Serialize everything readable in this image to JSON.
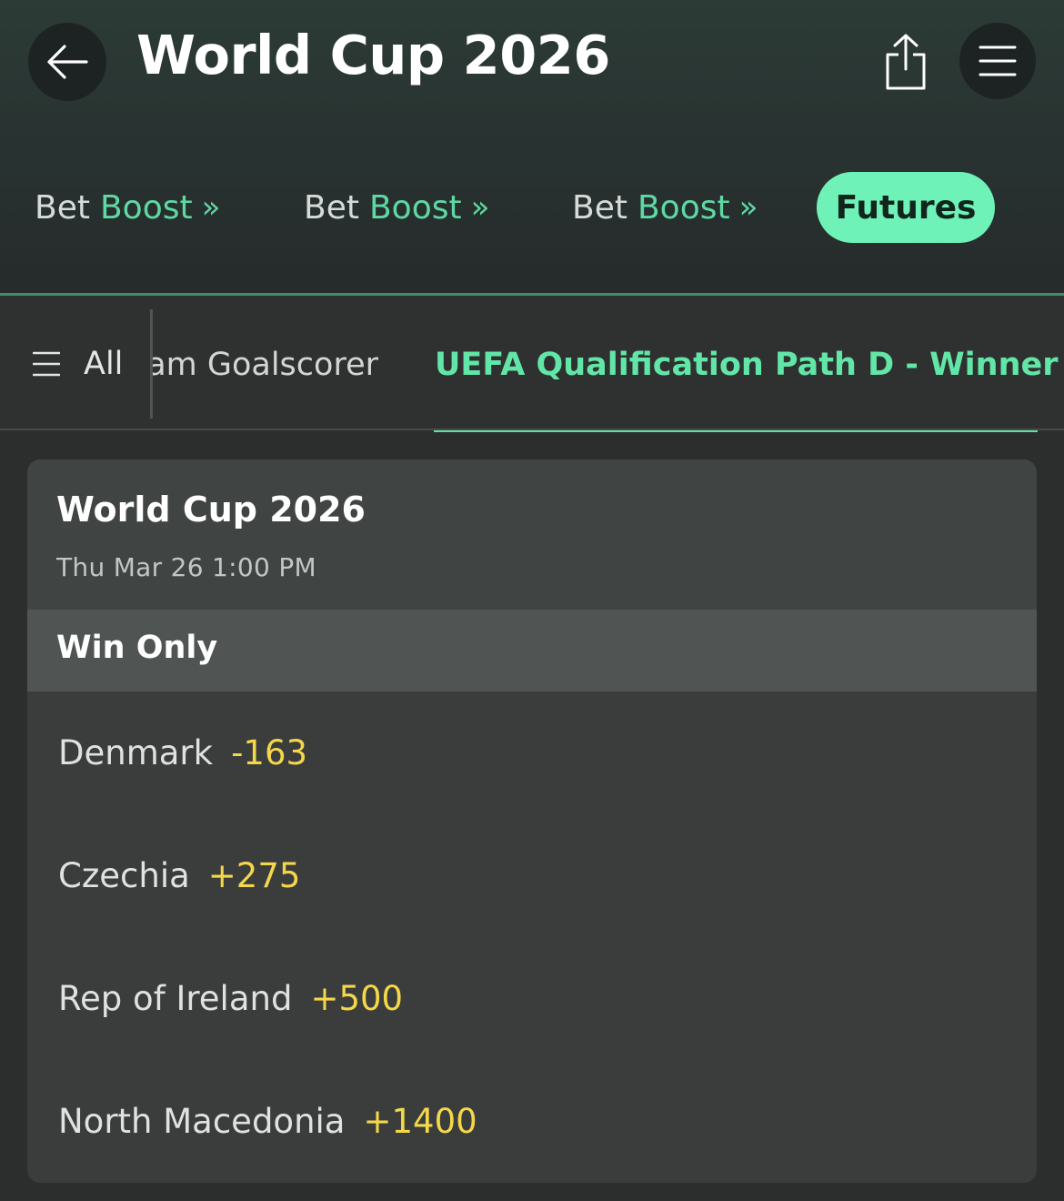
{
  "header": {
    "title": "World Cup 2026",
    "back_icon": "arrow-left-icon",
    "share_icon": "share-icon",
    "menu_icon": "hamburger-menu-icon"
  },
  "top_tabs": [
    {
      "word1": "Bet",
      "word2": "Boost",
      "chevron": "»"
    },
    {
      "word1": "Bet",
      "word2": "Boost",
      "chevron": "»"
    },
    {
      "word1": "Bet",
      "word2": "Boost",
      "chevron": "»"
    }
  ],
  "futures_tab": {
    "label": "Futures",
    "active": true
  },
  "sub_tabs": {
    "all_label": "All",
    "partial_tab": "am Goalscorer",
    "active_tab": "UEFA Qualification Path D - Winner"
  },
  "event": {
    "title": "World Cup 2026",
    "datetime": "Thu Mar 26 1:00 PM",
    "market": "Win Only",
    "selections": [
      {
        "name": "Denmark",
        "odds": "-163"
      },
      {
        "name": "Czechia",
        "odds": "+275"
      },
      {
        "name": "Rep of Ireland",
        "odds": "+500"
      },
      {
        "name": "North Macedonia",
        "odds": "+1400"
      }
    ]
  },
  "colors": {
    "accent_green": "#6ff2b8",
    "odds_yellow": "#f5d74a",
    "background": "#2b2e2d"
  }
}
